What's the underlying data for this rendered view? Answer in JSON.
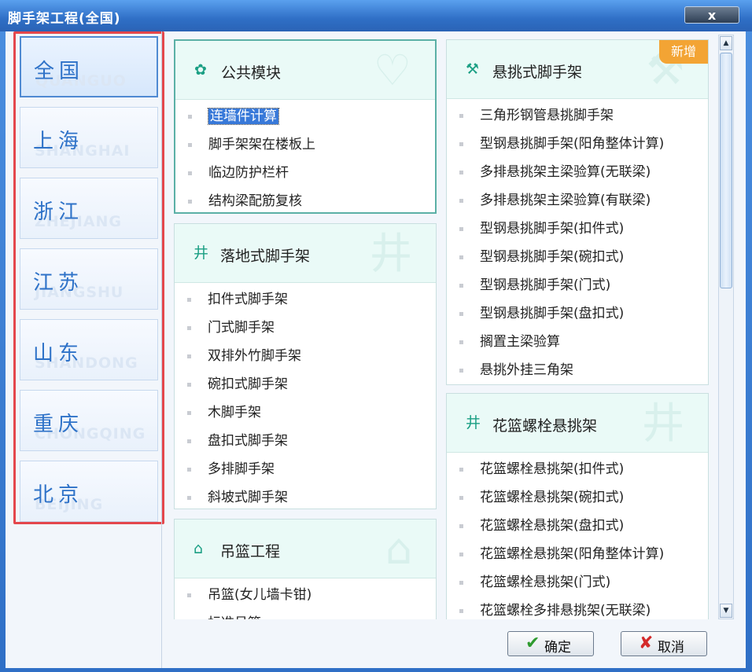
{
  "window": {
    "title": "脚手架工程(全国)",
    "close_label": "x"
  },
  "sidebar": {
    "items": [
      {
        "name": "全国",
        "pinyin": "QUANGUO",
        "active": true
      },
      {
        "name": "上海",
        "pinyin": "SHANGHAI",
        "active": false
      },
      {
        "name": "浙江",
        "pinyin": "ZHEJIANG",
        "active": false
      },
      {
        "name": "江苏",
        "pinyin": "JIANGSHU",
        "active": false
      },
      {
        "name": "山东",
        "pinyin": "SHANDONG",
        "active": false
      },
      {
        "name": "重庆",
        "pinyin": "CHONGQING",
        "active": false
      },
      {
        "name": "北京",
        "pinyin": "BEIJING",
        "active": false
      }
    ]
  },
  "panels": {
    "public": {
      "title": "公共模块",
      "icon": "handshake-icon",
      "items": [
        "连墙件计算",
        "脚手架架在楼板上",
        "临边防护栏杆",
        "结构梁配筋复核"
      ],
      "selected_item": "连墙件计算"
    },
    "floor": {
      "title": "落地式脚手架",
      "icon": "scaffold-icon",
      "items": [
        "扣件式脚手架",
        "门式脚手架",
        "双排外竹脚手架",
        "碗扣式脚手架",
        "木脚手架",
        "盘扣式脚手架",
        "多排脚手架",
        "斜坡式脚手架"
      ]
    },
    "basket": {
      "title": "吊篮工程",
      "icon": "building-icon",
      "items": [
        "吊篮(女儿墙卡钳)",
        "标准吊篮"
      ]
    },
    "cantilever": {
      "title": "悬挑式脚手架",
      "icon": "crane-icon",
      "badge": "新增",
      "items": [
        "三角形钢管悬挑脚手架",
        "型钢悬挑脚手架(阳角整体计算)",
        "多排悬挑架主梁验算(无联梁)",
        "多排悬挑架主梁验算(有联梁)",
        "型钢悬挑脚手架(扣件式)",
        "型钢悬挑脚手架(碗扣式)",
        "型钢悬挑脚手架(门式)",
        "型钢悬挑脚手架(盘扣式)",
        "搁置主梁验算",
        "悬挑外挂三角架"
      ]
    },
    "flower": {
      "title": "花篮螺栓悬挑架",
      "icon": "scaffold-icon",
      "items": [
        "花篮螺栓悬挑架(扣件式)",
        "花篮螺栓悬挑架(碗扣式)",
        "花篮螺栓悬挑架(盘扣式)",
        "花篮螺栓悬挑架(阳角整体计算)",
        "花篮螺栓悬挑架(门式)",
        "花篮螺栓多排悬挑架(无联梁)"
      ]
    }
  },
  "buttons": {
    "ok": "确定",
    "cancel": "取消"
  },
  "colors": {
    "accent": "#2e72c8",
    "panel_header": "#eafaf7",
    "badge": "#f3a434",
    "highlight": "#e4474c"
  }
}
